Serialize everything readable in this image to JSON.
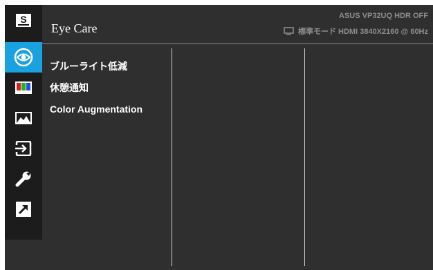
{
  "title": "Eye Care",
  "model_info": "ASUS  VP32UQ  HDR OFF",
  "mode_info": "標準モード  HDMI 3840X2160 @ 60Hz",
  "menu_items": [
    "ブルーライト低減",
    "休憩通知",
    "Color Augmentation"
  ],
  "sidebar": {
    "splendid_label": "S",
    "icons": [
      "splendid-icon",
      "eye-icon",
      "color-bars-icon",
      "image-icon",
      "input-icon",
      "wrench-icon",
      "shortcut-icon"
    ],
    "active_index": 1
  },
  "colors": {
    "accent": "#1aa1e0",
    "panel": "#2f2f2f",
    "sidebar": "#1c1c1c"
  }
}
